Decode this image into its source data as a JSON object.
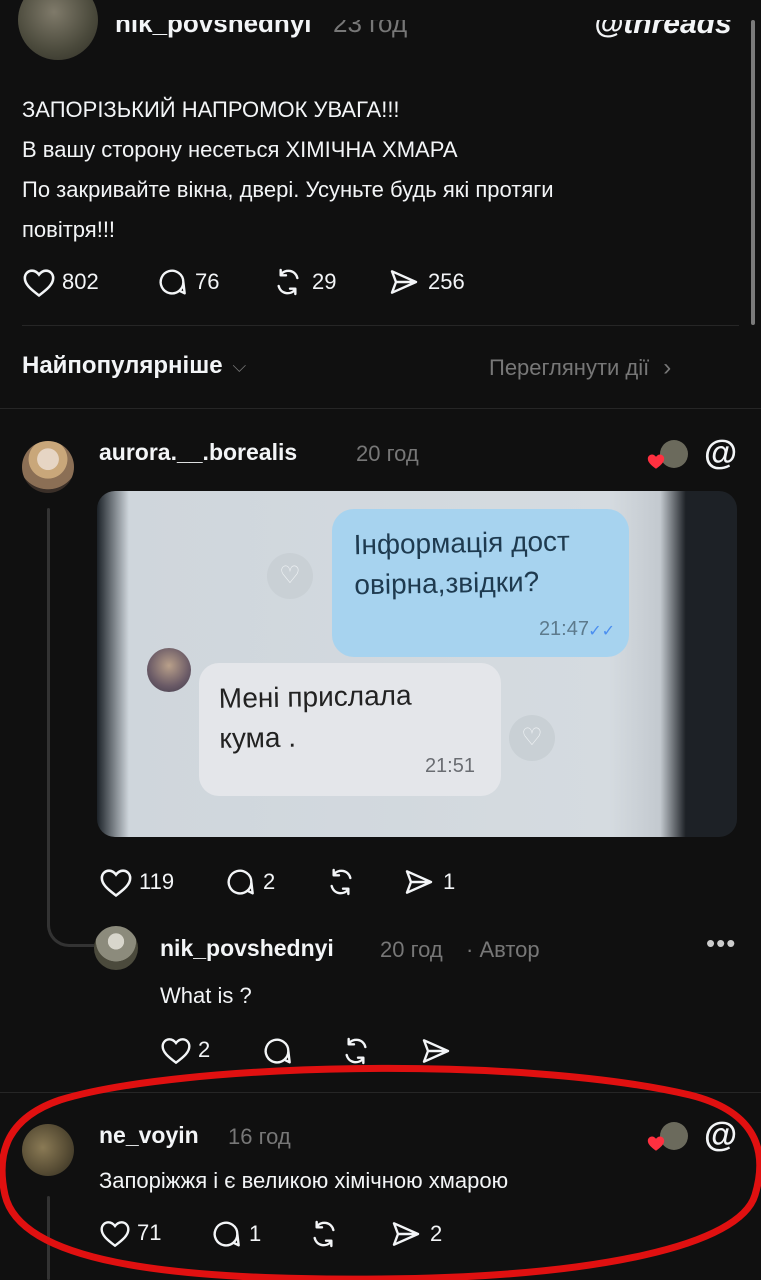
{
  "app": {
    "logo_label": "threads"
  },
  "post": {
    "username": "nik_povshednyi",
    "time": "23 год",
    "lines": [
      "ЗАПОРІЗЬКИЙ НАПРОМОК УВАГА!!!",
      "В вашу сторону несеться ХІМІЧНА ХМАРА",
      "По закривайте вікна, двері. Усуньте будь які протяги",
      "повітря!!!"
    ],
    "likes": "802",
    "replies": "76",
    "reposts": "29",
    "shares": "256"
  },
  "sort": {
    "label": "Найпопулярніше",
    "activity_link": "Переглянути дії"
  },
  "comments": [
    {
      "username": "aurora.__.borealis",
      "time": "20 год",
      "image": {
        "bubble_out_text": "Інформація дост овірна,звідки?",
        "bubble_out_time": "21:47",
        "bubble_in_text": "Мені прислала кума .",
        "bubble_in_time": "21:51"
      },
      "likes": "119",
      "replies": "2",
      "reposts": "",
      "shares": "1"
    },
    {
      "username": "nik_povshednyi",
      "time": "20 год",
      "author_tag": "· Автор",
      "text": "What is ?",
      "likes": "2"
    },
    {
      "username": "ne_voyin",
      "time": "16 год",
      "text": "Запоріжжя і є великою хімічною хмарою",
      "likes": "71",
      "replies": "1",
      "shares": "2"
    }
  ],
  "colors": {
    "background": "#101010",
    "annotation_circle": "#e01010",
    "liked_heart": "#ff3040",
    "read_tick": "#4a8ef0"
  }
}
